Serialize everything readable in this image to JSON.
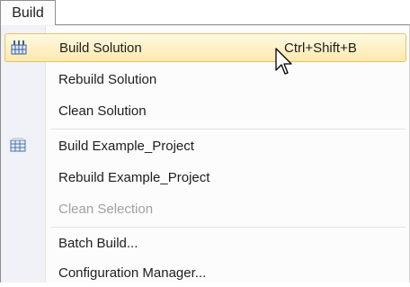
{
  "menubar": {
    "active_menu": "Build"
  },
  "menu": {
    "items": [
      {
        "label": "Build Solution",
        "shortcut": "Ctrl+Shift+B",
        "icon": "build-solution-icon",
        "highlighted": true
      },
      {
        "label": "Rebuild Solution"
      },
      {
        "label": "Clean Solution"
      },
      {
        "label": "Build Example_Project",
        "icon": "build-project-icon"
      },
      {
        "label": "Rebuild Example_Project"
      },
      {
        "label": "Clean Selection",
        "disabled": true
      },
      {
        "label": "Batch Build..."
      },
      {
        "label": "Configuration Manager..."
      }
    ]
  },
  "colors": {
    "highlight_top": "#fff9e2",
    "highlight_bottom": "#fde9ad",
    "highlight_border": "#e5c365",
    "disabled_text": "#a0a0a0"
  }
}
